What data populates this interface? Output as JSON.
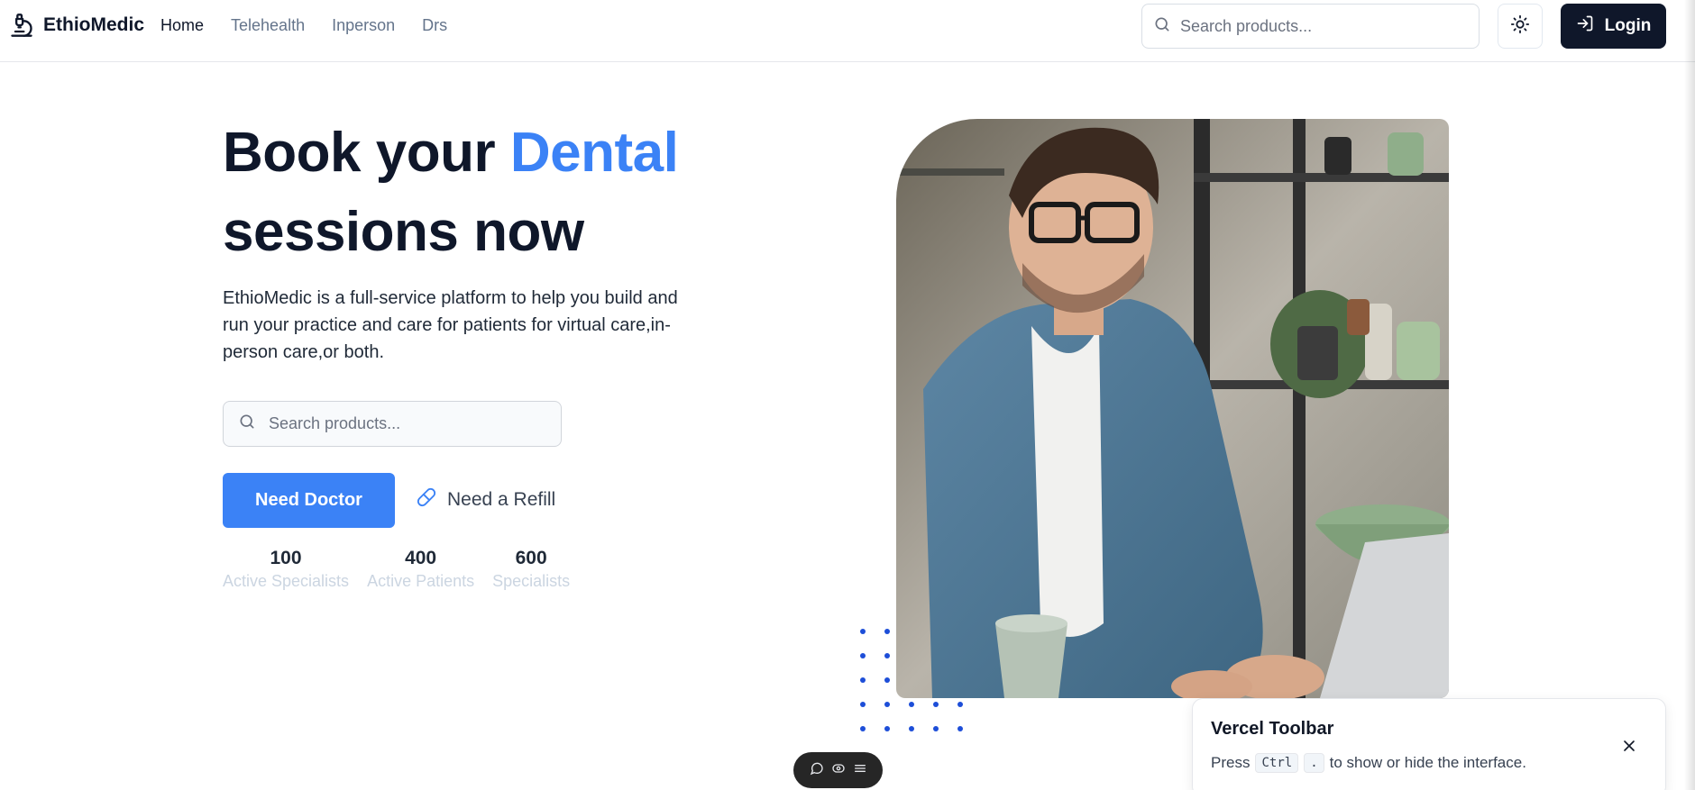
{
  "brand": {
    "name": "EthioMedic",
    "icon": "microscope-icon"
  },
  "nav": [
    {
      "label": "Home",
      "active": true
    },
    {
      "label": "Telehealth",
      "active": false
    },
    {
      "label": "Inperson",
      "active": false
    },
    {
      "label": "Drs",
      "active": false
    }
  ],
  "header": {
    "search_placeholder": "Search products...",
    "theme_icon": "sun-icon",
    "login_label": "Login",
    "login_icon": "log-in-icon"
  },
  "hero": {
    "title_before": "Book your ",
    "title_accent": "Dental",
    "title_after": "sessions now",
    "description": "EthioMedic is a full-service platform to help you build and run your practice and care for patients for virtual care,in-person care,or both.",
    "search_placeholder": "Search products...",
    "primary_button": "Need Doctor",
    "secondary_button": "Need a Refill",
    "secondary_icon": "pill-icon"
  },
  "stats": [
    {
      "value": "100",
      "label": "Active Specialists"
    },
    {
      "value": "400",
      "label": "Active Patients"
    },
    {
      "value": "600",
      "label": "Specialists"
    }
  ],
  "toolbar_pill": {
    "icons": [
      "comment-icon",
      "eye-icon",
      "menu-icon"
    ]
  },
  "toast": {
    "title": "Vercel Toolbar",
    "press": "Press",
    "key1": "Ctrl",
    "key2": ".",
    "rest": "to show or hide the interface."
  },
  "colors": {
    "accent": "#3b82f6",
    "dark": "#0f172a",
    "muted": "#64748b",
    "dots": "#1d4ed8"
  }
}
